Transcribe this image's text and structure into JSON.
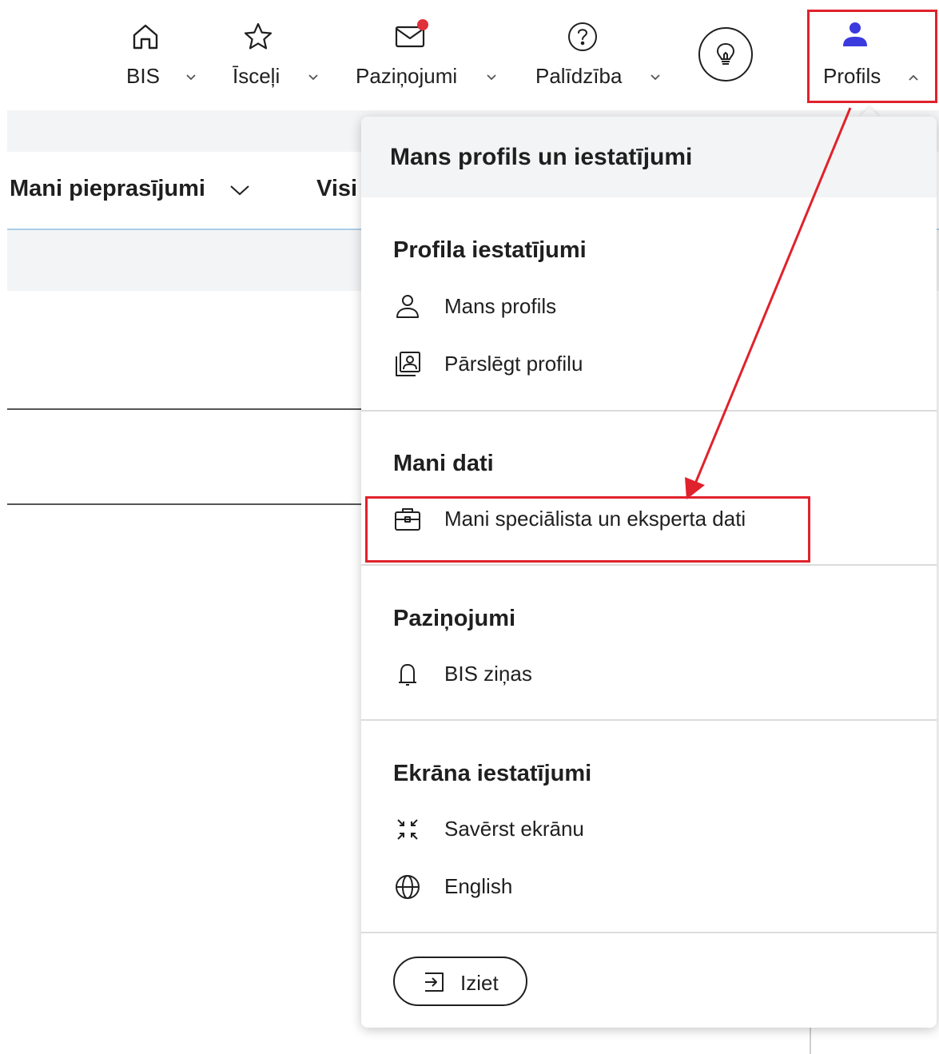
{
  "nav": {
    "items": [
      {
        "label": "BIS",
        "icon": "home-icon"
      },
      {
        "label": "Īsceļi",
        "icon": "star-icon"
      },
      {
        "label": "Paziņojumi",
        "icon": "mail-icon"
      },
      {
        "label": "Palīdzība",
        "icon": "help-icon"
      },
      {
        "label": "Profils",
        "icon": "person-icon"
      }
    ],
    "idea_button_icon": "lightbulb-icon"
  },
  "background": {
    "tabs": [
      {
        "label": "Mani pieprasījumi"
      },
      {
        "label": "Visi"
      }
    ]
  },
  "dropdown": {
    "title": "Mans profils un iestatījumi",
    "sections": [
      {
        "title": "Profila iestatījumi",
        "items": [
          {
            "label": "Mans profils",
            "icon": "person-outline-icon"
          },
          {
            "label": "Pārslēgt profilu",
            "icon": "switch-profile-icon"
          }
        ]
      },
      {
        "title": "Mani dati",
        "items": [
          {
            "label": "Mani speciālista un eksperta dati",
            "icon": "briefcase-icon"
          }
        ]
      },
      {
        "title": "Paziņojumi",
        "items": [
          {
            "label": "BIS ziņas",
            "icon": "bell-icon"
          }
        ]
      },
      {
        "title": "Ekrāna iestatījumi",
        "items": [
          {
            "label": "Savērst ekrānu",
            "icon": "collapse-screen-icon"
          },
          {
            "label": "English",
            "icon": "globe-icon"
          }
        ]
      }
    ],
    "logout_label": "Iziet",
    "logout_icon": "logout-icon"
  },
  "colors": {
    "accent": "#3a3adf",
    "annotation": "#e0222c",
    "notification_dot": "#e0313a",
    "panel_header_bg": "#f3f4f5"
  }
}
